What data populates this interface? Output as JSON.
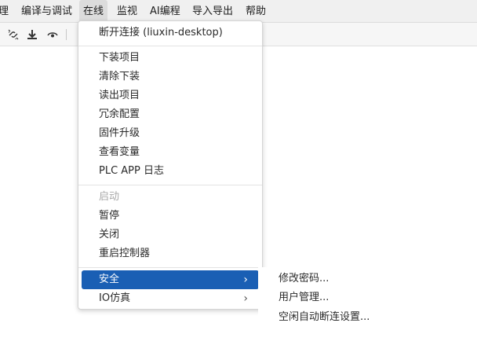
{
  "menubar": {
    "items": [
      {
        "label": "理"
      },
      {
        "label": "编译与调试"
      },
      {
        "label": "在线"
      },
      {
        "label": "监视"
      },
      {
        "label": "AI编程"
      },
      {
        "label": "导入导出"
      },
      {
        "label": "帮助"
      }
    ]
  },
  "toolbar": {
    "icons": [
      "disconnect-icon",
      "download-icon",
      "eye-icon"
    ]
  },
  "online_menu": {
    "items": [
      {
        "label": "断开连接 (liuxin-desktop)"
      },
      {
        "label": "下装项目"
      },
      {
        "label": "清除下装"
      },
      {
        "label": "读出项目"
      },
      {
        "label": "冗余配置"
      },
      {
        "label": "固件升级"
      },
      {
        "label": "查看变量"
      },
      {
        "label": "PLC APP 日志"
      },
      {
        "label": "启动"
      },
      {
        "label": "暂停"
      },
      {
        "label": "关闭"
      },
      {
        "label": "重启控制器"
      },
      {
        "label": "安全"
      },
      {
        "label": "IO仿真"
      }
    ],
    "arrow": "›"
  },
  "security_submenu": {
    "items": [
      {
        "label": "修改密码..."
      },
      {
        "label": "用户管理..."
      },
      {
        "label": "空闲自动断连设置..."
      }
    ]
  },
  "colors": {
    "highlight": "#1a5fb4",
    "disabled_text": "#a8a8a8"
  }
}
